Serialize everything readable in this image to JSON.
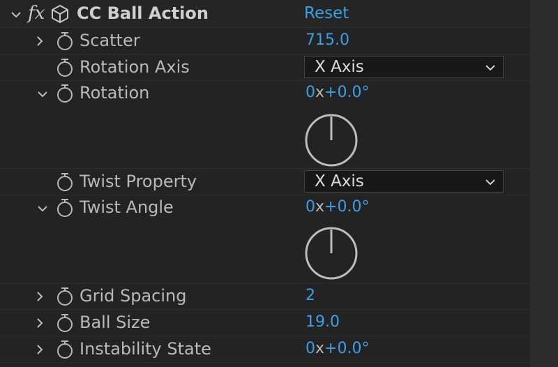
{
  "effect": {
    "name": "CC Ball Action",
    "fx_glyph": "fx",
    "reset_label": "Reset",
    "icon": "cube-icon"
  },
  "properties": [
    {
      "id": "scatter",
      "label": "Scatter",
      "value": "715.0",
      "twirl": "collapsed"
    },
    {
      "id": "rotation-axis",
      "label": "Rotation Axis",
      "dropdown": "X Axis"
    },
    {
      "id": "rotation",
      "label": "Rotation",
      "revolutions": "0",
      "degrees": "+0.0°",
      "twirl": "expanded"
    },
    {
      "id": "twist-property",
      "label": "Twist Property",
      "dropdown": "X Axis"
    },
    {
      "id": "twist-angle",
      "label": "Twist Angle",
      "revolutions": "0",
      "degrees": "+0.0°",
      "twirl": "expanded"
    },
    {
      "id": "grid-spacing",
      "label": "Grid Spacing",
      "value": "2",
      "twirl": "collapsed"
    },
    {
      "id": "ball-size",
      "label": "Ball Size",
      "value": "19.0",
      "twirl": "collapsed"
    },
    {
      "id": "instability-state",
      "label": "Instability State",
      "revolutions": "0",
      "degrees": "+0.0°",
      "twirl": "collapsed"
    }
  ],
  "colors": {
    "background": "#232323",
    "value_blue": "#3aa0e8",
    "label_gray": "#b9b9b9"
  }
}
